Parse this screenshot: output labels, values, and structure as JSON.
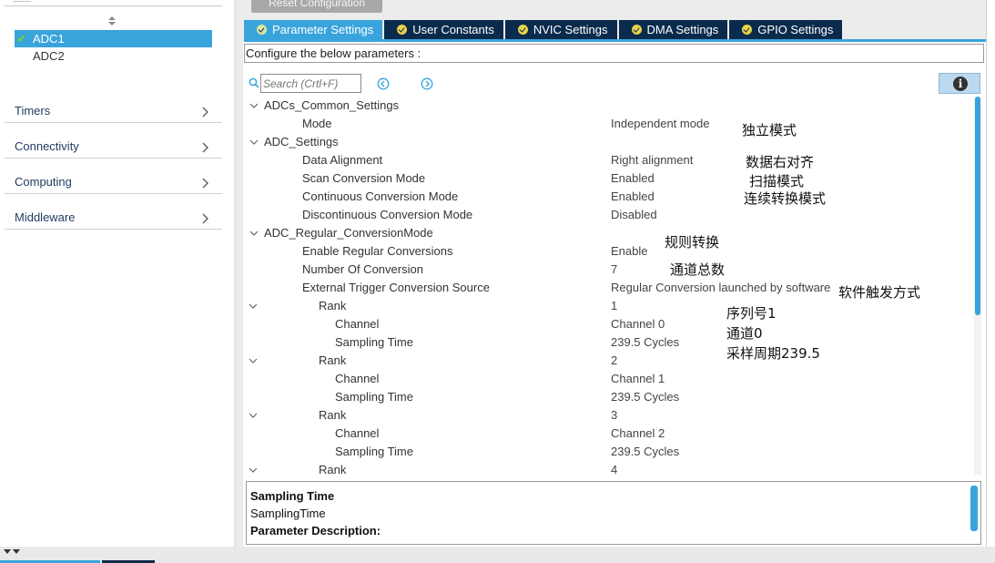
{
  "left_panel": {
    "items": [
      {
        "label": "ADC1",
        "selected": true,
        "status": "check"
      },
      {
        "label": "ADC2",
        "selected": false
      }
    ],
    "categories": [
      {
        "label": "Timers"
      },
      {
        "label": "Connectivity"
      },
      {
        "label": "Computing"
      },
      {
        "label": "Middleware"
      }
    ]
  },
  "toolbar": {
    "reset_label": "Reset Configuration"
  },
  "tabs": [
    {
      "label": "Parameter Settings",
      "active": true
    },
    {
      "label": "User Constants",
      "active": false
    },
    {
      "label": "NVIC Settings",
      "active": false
    },
    {
      "label": "DMA Settings",
      "active": false
    },
    {
      "label": "GPIO Settings",
      "active": false
    }
  ],
  "config_header": "Configure the below parameters :",
  "search": {
    "placeholder": "Search (Crtl+F)"
  },
  "tree": [
    {
      "label": "ADCs_Common_Settings",
      "value": "",
      "indent": 0,
      "expander": true
    },
    {
      "label": "Mode",
      "value": "Independent mode",
      "indent": 2,
      "expander": false
    },
    {
      "label": "ADC_Settings",
      "value": "",
      "indent": 0,
      "expander": true
    },
    {
      "label": "Data Alignment",
      "value": "Right alignment",
      "indent": 2,
      "expander": false
    },
    {
      "label": "Scan Conversion Mode",
      "value": "Enabled",
      "indent": 2,
      "expander": false
    },
    {
      "label": "Continuous Conversion Mode",
      "value": "Enabled",
      "indent": 2,
      "expander": false
    },
    {
      "label": "Discontinuous Conversion Mode",
      "value": "Disabled",
      "indent": 2,
      "expander": false
    },
    {
      "label": "ADC_Regular_ConversionMode",
      "value": "",
      "indent": 0,
      "expander": true
    },
    {
      "label": "Enable Regular Conversions",
      "value": "Enable",
      "indent": 2,
      "expander": false
    },
    {
      "label": "Number Of Conversion",
      "value": "7",
      "indent": 2,
      "expander": false
    },
    {
      "label": "External Trigger Conversion Source",
      "value": "Regular Conversion launched by software",
      "indent": 2,
      "expander": false
    },
    {
      "label": "Rank",
      "value": "1",
      "indent": 3,
      "expander": true
    },
    {
      "label": "Channel",
      "value": "Channel 0",
      "indent": 4,
      "expander": false
    },
    {
      "label": "Sampling Time",
      "value": "239.5 Cycles",
      "indent": 4,
      "expander": false
    },
    {
      "label": "Rank",
      "value": "2",
      "indent": 3,
      "expander": true
    },
    {
      "label": "Channel",
      "value": "Channel 1",
      "indent": 4,
      "expander": false
    },
    {
      "label": "Sampling Time",
      "value": "239.5 Cycles",
      "indent": 4,
      "expander": false
    },
    {
      "label": "Rank",
      "value": "3",
      "indent": 3,
      "expander": true
    },
    {
      "label": "Channel",
      "value": "Channel 2",
      "indent": 4,
      "expander": false
    },
    {
      "label": "Sampling Time",
      "value": "239.5 Cycles",
      "indent": 4,
      "expander": false
    },
    {
      "label": "Rank",
      "value": "4",
      "indent": 3,
      "expander": true
    }
  ],
  "annotations": [
    {
      "text": "独立模式"
    },
    {
      "text": "数据右对齐"
    },
    {
      "text": "扫描模式"
    },
    {
      "text": "连续转换模式"
    },
    {
      "text": "规则转换"
    },
    {
      "text": "通道总数"
    },
    {
      "text": "软件触发方式"
    },
    {
      "text": "序列号1"
    },
    {
      "text": "通道0"
    },
    {
      "text": "采样周期239.5"
    }
  ],
  "description": {
    "title": "Sampling Time",
    "name": "SamplingTime",
    "desc_label": "Parameter Description:"
  },
  "colors": {
    "accent": "#39a4dc",
    "tab_dark": "#0b2b4c",
    "check_green": "#7ed321",
    "nav_text": "#1f3a5f"
  }
}
